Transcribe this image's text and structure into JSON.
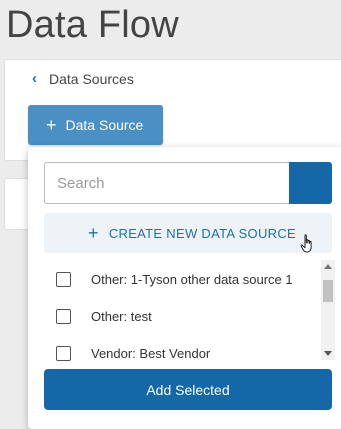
{
  "page": {
    "title": "Data Flow"
  },
  "nav": {
    "back_label": "Data Sources"
  },
  "toolbar": {
    "add_label": "Data Source"
  },
  "dropdown": {
    "search_placeholder": "Search",
    "search_value": "",
    "create_new_label": "CREATE NEW DATA SOURCE",
    "items": [
      {
        "label": "Other: 1-Tyson other data source 1",
        "checked": false
      },
      {
        "label": "Other: test",
        "checked": false
      },
      {
        "label": "Vendor: Best Vendor",
        "checked": false
      }
    ],
    "add_selected_label": "Add Selected"
  },
  "colors": {
    "primary": "#1568a8",
    "button_light": "#4a90c4",
    "link": "#1f6fad",
    "create_bg": "#eef3f8"
  },
  "icons": {
    "back": "chevron-left-icon",
    "add": "plus-icon",
    "search": "search-icon",
    "cursor": "hand-pointer-icon"
  }
}
